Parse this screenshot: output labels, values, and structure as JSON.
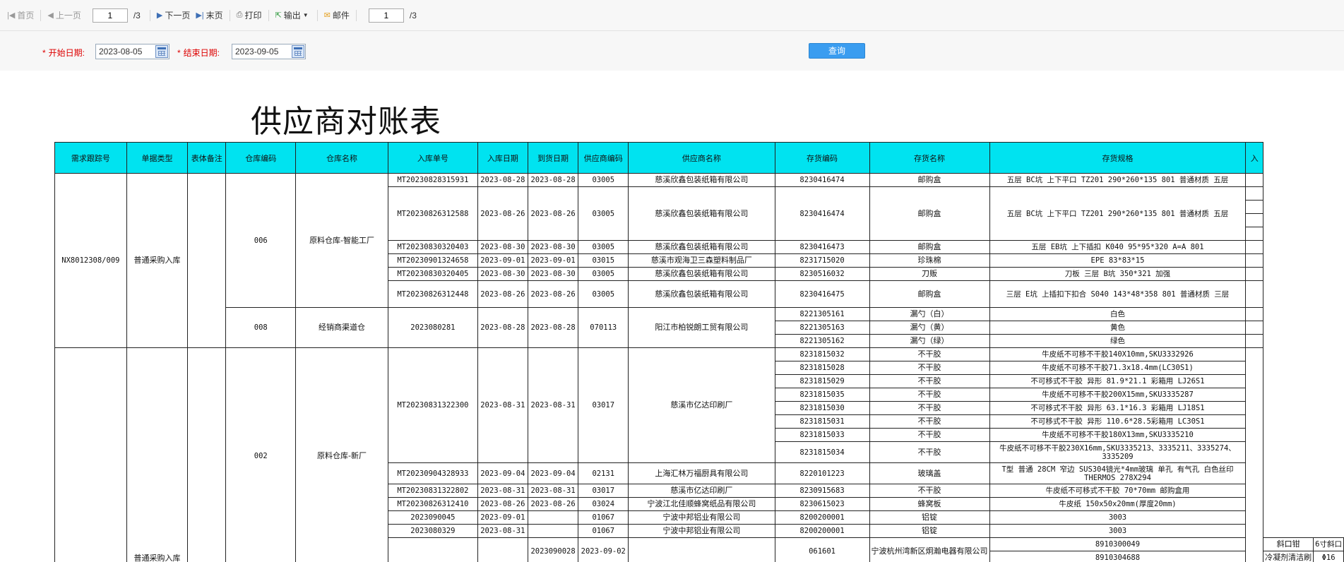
{
  "toolbar": {
    "first": "首页",
    "prev": "上一页",
    "page_value": "1",
    "page_total": "/3",
    "next": "下一页",
    "last": "末页",
    "print": "打印",
    "export": "输出",
    "mail": "邮件",
    "page_value2": "1",
    "page_total2": "/3"
  },
  "filter": {
    "start_label": "开始日期:",
    "start_value": "2023-08-05",
    "end_label": "结束日期:",
    "end_value": "2023-09-05",
    "required_mark": "*",
    "query_button": "查询"
  },
  "report": {
    "title": "供应商对账表",
    "columns": [
      "需求跟踪号",
      "单据类型",
      "表体备注",
      "仓库编码",
      "仓库名称",
      "入库单号",
      "入库日期",
      "到货日期",
      "供应商编码",
      "供应商名称",
      "存货编码",
      "存货名称",
      "存货规格",
      "入"
    ],
    "groups": {
      "g1": {
        "trace_no": "NX8012308/009",
        "doc_type": "普通采购入库",
        "wh_a": {
          "code": "006",
          "name": "原料仓库-智能工厂"
        },
        "wh_b": {
          "code": "008",
          "name": "经销商渠道仓"
        }
      },
      "g2": {
        "wh_c": {
          "code": "002",
          "name": "原料仓库-新厂"
        },
        "doc_type_bottom": "普通采购入库"
      }
    },
    "receipts": {
      "r1": {
        "no": "MT20230828315931",
        "in": "2023-08-28",
        "arr": "2023-08-28",
        "sup_code": "03005",
        "sup_name": "慈溪欣鑫包装纸箱有限公司"
      },
      "r2": {
        "no": "MT20230826312588",
        "in": "2023-08-26",
        "arr": "2023-08-26",
        "sup_code": "03005",
        "sup_name": "慈溪欣鑫包装纸箱有限公司"
      },
      "r3": {
        "no": "MT20230830320403",
        "in": "2023-08-30",
        "arr": "2023-08-30",
        "sup_code": "03005",
        "sup_name": "慈溪欣鑫包装纸箱有限公司"
      },
      "r4": {
        "no": "MT20230901324658",
        "in": "2023-09-01",
        "arr": "2023-09-01",
        "sup_code": "03015",
        "sup_name": "慈溪市观海卫三森塑料制品厂"
      },
      "r5": {
        "no": "MT20230830320405",
        "in": "2023-08-30",
        "arr": "2023-08-30",
        "sup_code": "03005",
        "sup_name": "慈溪欣鑫包装纸箱有限公司"
      },
      "r6": {
        "no": "MT20230826312448",
        "in": "2023-08-26",
        "arr": "2023-08-26",
        "sup_code": "03005",
        "sup_name": "慈溪欣鑫包装纸箱有限公司"
      },
      "r7": {
        "no": "2023080281",
        "in": "2023-08-28",
        "arr": "2023-08-28",
        "sup_code": "070113",
        "sup_name": "阳江市柏锐朗工贸有限公司"
      },
      "r8": {
        "no": "MT20230831322300",
        "in": "2023-08-31",
        "arr": "2023-08-31",
        "sup_code": "03017",
        "sup_name": "慈溪市亿达印刷厂"
      },
      "r9": {
        "no": "MT20230904328933",
        "in": "2023-09-04",
        "arr": "2023-09-04",
        "sup_code": "02131",
        "sup_name": "上海汇林万福厨具有限公司"
      },
      "r10": {
        "no": "MT20230831322802",
        "in": "2023-08-31",
        "arr": "2023-08-31",
        "sup_code": "03017",
        "sup_name": "慈溪市亿达印刷厂"
      },
      "r11": {
        "no": "MT20230826312410",
        "in": "2023-08-26",
        "arr": "2023-08-26",
        "sup_code": "03024",
        "sup_name": "宁波江北佳顺蜂窝纸品有限公司"
      },
      "r12": {
        "no": "2023090045",
        "in": "2023-09-01",
        "arr": "",
        "sup_code": "01067",
        "sup_name": "宁波中邦铝业有限公司"
      },
      "r13": {
        "no": "2023080329",
        "in": "2023-08-31",
        "arr": "",
        "sup_code": "01067",
        "sup_name": "宁波中邦铝业有限公司"
      },
      "r14": {
        "no": "2023090028",
        "in": "2023-09-02",
        "arr": "",
        "sup_code": "061601",
        "sup_name": "宁波杭州湾新区炯瀚电器有限公司"
      }
    },
    "items": {
      "i1": {
        "code": "8230416474",
        "name": "邮购盒",
        "spec": "五层 BC坑 上下平口 TZ201 290*260*135 801 普通材质    五层"
      },
      "i2": {
        "code": "8230416474",
        "name": "邮购盒",
        "spec": "五层 BC坑 上下平口 TZ201 290*260*135 801 普通材质    五层"
      },
      "i3": {
        "code": "8230416473",
        "name": "邮购盒",
        "spec": "五层 EB坑 上下插扣 K040 95*95*320    A=A 801"
      },
      "i4": {
        "code": "8231715020",
        "name": "珍珠棉",
        "spec": "EPE 83*83*15"
      },
      "i5": {
        "code": "8230516032",
        "name": "刀贩",
        "spec": "刀板 三层 B坑 350*321 加强"
      },
      "i6": {
        "code": "8230416475",
        "name": "邮购盒",
        "spec": "三层 E坑 上插扣下扣合 S040 143*48*358 801 普通材质    三层"
      },
      "i7": {
        "code": "8221305161",
        "name": "漏勺（白）",
        "spec": "白色"
      },
      "i8": {
        "code": "8221305163",
        "name": "漏勺（黄）",
        "spec": "黄色"
      },
      "i9": {
        "code": "8221305162",
        "name": "漏勺（绿）",
        "spec": "绿色"
      },
      "i10": {
        "code": "8231815032",
        "name": "不干胶",
        "spec": "牛皮纸不可移不干胶140X10mm,SKU3332926"
      },
      "i11": {
        "code": "8231815028",
        "name": "不干胶",
        "spec": "牛皮纸不可移不干胶71.3x18.4mm(LC30S1)"
      },
      "i12": {
        "code": "8231815029",
        "name": "不干胶",
        "spec": "不可移式不干胶 异形 81.9*21.1 彩箱用 LJ26S1"
      },
      "i13": {
        "code": "8231815035",
        "name": "不干胶",
        "spec": "牛皮纸不可移不干胶200X15mm,SKU3335287"
      },
      "i14": {
        "code": "8231815030",
        "name": "不干胶",
        "spec": "不可移式不干胶 异形 63.1*16.3 彩箱用 LJ18S1"
      },
      "i15": {
        "code": "8231815031",
        "name": "不干胶",
        "spec": "不可移式不干胶 异形 110.6*28.5彩箱用 LC30S1"
      },
      "i16": {
        "code": "8231815033",
        "name": "不干胶",
        "spec": "牛皮纸不可移不干胶180X13mm,SKU3335210"
      },
      "i17": {
        "code": "8231815034",
        "name": "不干胶",
        "spec": "牛皮纸不可移不干胶230X16mm,SKU3335213、3335211、3335274、3335209"
      },
      "i18": {
        "code": "8220101223",
        "name": "玻璃盖",
        "spec": "T型 普通 28CM 窄边 SUS304镜光*4mm玻璃 单孔 有气孔 白色丝印 THERMOS    278X294"
      },
      "i19": {
        "code": "8230915683",
        "name": "不干胶",
        "spec": "牛皮纸不可移式不干胶    70*70mm 邮购盒用"
      },
      "i20": {
        "code": "8230615023",
        "name": "蜂窝板",
        "spec": "牛皮纸 150x50x20mm(厚度20mm)"
      },
      "i21": {
        "code": "8200200001",
        "name": "铝锭",
        "spec": "3003"
      },
      "i22": {
        "code": "8200200001",
        "name": "铝锭",
        "spec": "3003"
      },
      "i23": {
        "code": "8910300049",
        "name": "斜口钳",
        "spec": "6寸斜口"
      },
      "i24": {
        "code": "8910304688",
        "name": "冷凝剂清洁刷",
        "spec": "Φ16"
      }
    }
  }
}
